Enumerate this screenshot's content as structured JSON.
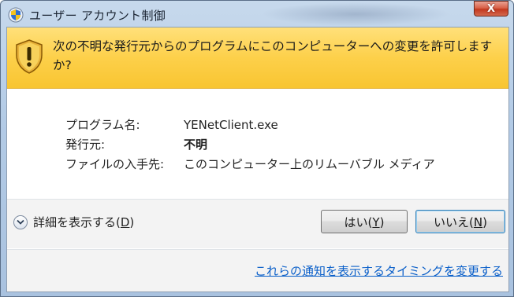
{
  "window": {
    "title": "ユーザー アカウント制御",
    "close_glyph": "X"
  },
  "banner": {
    "message": "次の不明な発行元からのプログラムにこのコンピューターへの変更を許可しますか?"
  },
  "details": {
    "rows": [
      {
        "label": "プログラム名:",
        "value": "YENetClient.exe"
      },
      {
        "label": "発行元:",
        "value": "不明"
      },
      {
        "label": "ファイルの入手先:",
        "value": "このコンピューター上のリムーバブル メディア"
      }
    ]
  },
  "actions": {
    "expand_prefix": "詳細を表示する(",
    "expand_key": "D",
    "expand_suffix": ")",
    "yes_prefix": "はい(",
    "yes_key": "Y",
    "yes_suffix": ")",
    "no_prefix": "いいえ(",
    "no_key": "N",
    "no_suffix": ")"
  },
  "footer": {
    "link": "これらの通知を表示するタイミングを変更する"
  },
  "colors": {
    "banner": "#fdd04a",
    "link": "#0a5fc9",
    "close": "#c2391f"
  }
}
